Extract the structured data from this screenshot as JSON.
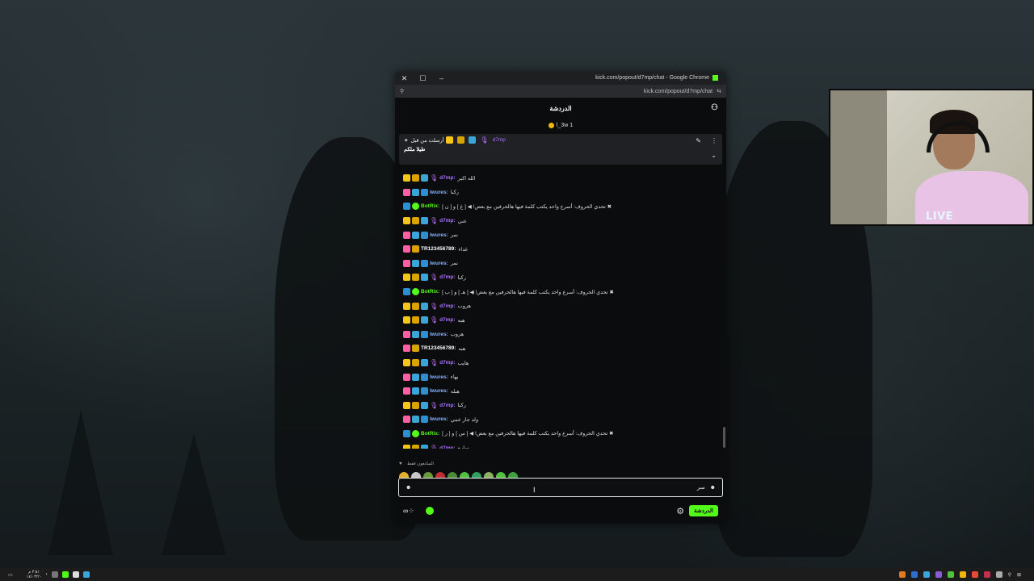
{
  "window": {
    "title": "kick.com/popout/d7mp/chat - Google Chrome",
    "address": "kick.com/popout/d7mp/chat",
    "address_domain": "kick.com"
  },
  "chat": {
    "header_title": "الدردشة",
    "gifter": "l_3w 1",
    "pinned": {
      "author": "d7mp",
      "meta": "أرسلت من قبل",
      "text": "طيلا ملكم"
    },
    "messages": [
      {
        "user": "d7mp",
        "badges": [
          "y",
          "o",
          "t",
          "mic"
        ],
        "color": "#b070ff",
        "text": "الله اكبر"
      },
      {
        "user": "lwures",
        "badges": [
          "p",
          "t",
          "s"
        ],
        "color": "#8ab4ff",
        "text": "ركبا"
      },
      {
        "user": "BotRix",
        "badges": [
          "s",
          "g"
        ],
        "color": "#53fc18",
        "text": "تحدي الحروف: أسرع واحد يكتب كلمة فيها هالحرفين مع بعض! ◀ [ غ ] و [ ن ] ✖"
      },
      {
        "user": "d7mp",
        "badges": [
          "y",
          "o",
          "t",
          "mic"
        ],
        "color": "#b070ff",
        "text": "عني"
      },
      {
        "user": "lwures",
        "badges": [
          "p",
          "t",
          "s"
        ],
        "color": "#8ab4ff",
        "text": "نمر"
      },
      {
        "user": "TR123456789",
        "badges": [
          "p",
          "o"
        ],
        "color": "#ffffff",
        "text": "غداء"
      },
      {
        "user": "lwures",
        "badges": [
          "p",
          "t",
          "s"
        ],
        "color": "#8ab4ff",
        "text": "نمر"
      },
      {
        "user": "d7mp",
        "badges": [
          "y",
          "o",
          "t",
          "mic"
        ],
        "color": "#b070ff",
        "text": "ركبا"
      },
      {
        "user": "BotRix",
        "badges": [
          "s",
          "g"
        ],
        "color": "#53fc18",
        "text": "تحدي الحروف: أسرع واحد يكتب كلمة فيها هالحرفين مع بعض! ◀ [ هـ ] و [ ب ] ✖"
      },
      {
        "user": "d7mp",
        "badges": [
          "y",
          "o",
          "t",
          "mic"
        ],
        "color": "#b070ff",
        "text": "هروب"
      },
      {
        "user": "d7mp",
        "badges": [
          "y",
          "o",
          "t",
          "mic"
        ],
        "color": "#b070ff",
        "text": "هبه"
      },
      {
        "user": "lwures",
        "badges": [
          "p",
          "t",
          "s"
        ],
        "color": "#8ab4ff",
        "text": "هروب"
      },
      {
        "user": "TR123456789",
        "badges": [
          "p",
          "o"
        ],
        "color": "#ffffff",
        "text": "هبه"
      },
      {
        "user": "d7mp",
        "badges": [
          "y",
          "o",
          "t",
          "mic"
        ],
        "color": "#b070ff",
        "text": "هايب"
      },
      {
        "user": "lwures",
        "badges": [
          "p",
          "t",
          "s"
        ],
        "color": "#8ab4ff",
        "text": "بهاء"
      },
      {
        "user": "lwures",
        "badges": [
          "p",
          "t",
          "s"
        ],
        "color": "#8ab4ff",
        "text": "هبله"
      },
      {
        "user": "d7mp",
        "badges": [
          "y",
          "o",
          "t",
          "mic"
        ],
        "color": "#b070ff",
        "text": "ركبا"
      },
      {
        "user": "lwures",
        "badges": [
          "p",
          "t",
          "s"
        ],
        "color": "#8ab4ff",
        "text": "ولد جار عمي"
      },
      {
        "user": "BotRix",
        "badges": [
          "s",
          "g"
        ],
        "color": "#53fc18",
        "text": "تحدي الحروف: أسرع واحد يكتب كلمة فيها هالحرفين مع بعض! ◀ [ س ] و [ ر ] ✖"
      },
      {
        "user": "d7mp",
        "badges": [
          "y",
          "o",
          "t",
          "mic"
        ],
        "color": "#b070ff",
        "text": "ساره"
      }
    ],
    "emote_label": "المتابعون فقط",
    "emote_colors": [
      "#e0b030",
      "#c8c8c8",
      "#6a9a3a",
      "#c03030",
      "#4a8a3a",
      "#53c040",
      "#30a060",
      "#8ab060",
      "#53c040",
      "#40a040"
    ],
    "input_value": "سر",
    "send_label": "الدردشة"
  },
  "webcam": {
    "live_label": "LIVE"
  },
  "taskbar": {
    "time": "٣:٥١ م",
    "date": "١٤/٠٣/٢٠"
  }
}
